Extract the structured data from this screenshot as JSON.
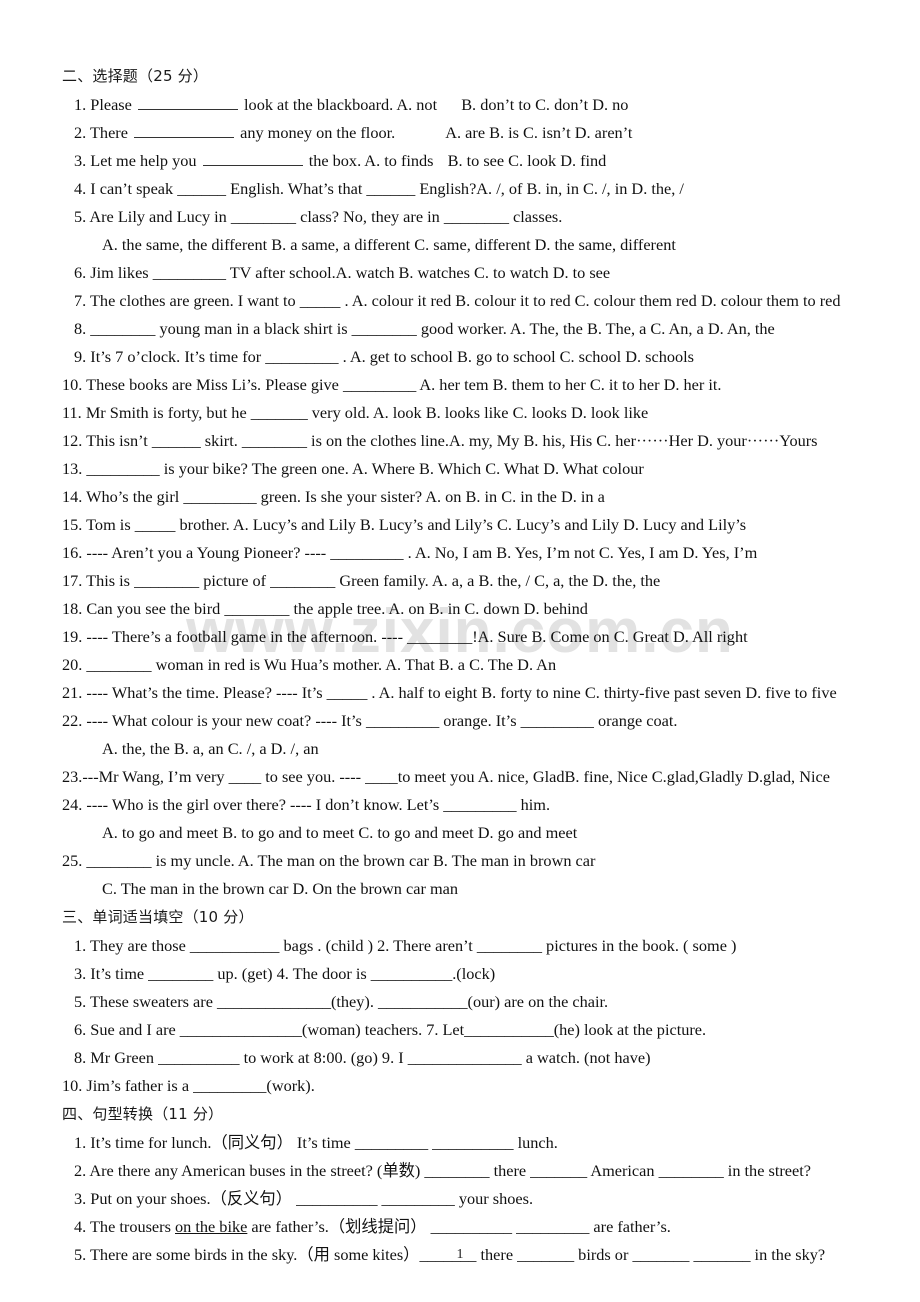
{
  "document": {
    "page_number": "1",
    "watermark": "www.zixin.com.cn"
  },
  "section2": {
    "heading": "二、选择题（25 分）",
    "questions": [
      {
        "id": "q1",
        "pre": "1. Please",
        "mid": "look at the blackboard. A. not",
        "opts": "B. don’t to     C. don’t        D. no"
      },
      {
        "id": "q2",
        "pre": "2. There",
        "mid": "any money on the floor.",
        "opts": "A. are     B. is C. isn’t   D. aren’t"
      },
      {
        "id": "q3",
        "pre": "3. Let me help you",
        "mid": "the box. A. to finds",
        "opts": "B. to see        C. look   D. find"
      },
      {
        "id": "q4",
        "line": "4. I can’t speak ______ English. What’s that ______ English?A. /, of      B. in, in   C. /, in     D. the, /"
      },
      {
        "id": "q5",
        "line": "5. Are Lily and Lucy in ________ class? No, they are in ________ classes."
      },
      {
        "id": "q5opts",
        "line": "A. the same, the different      B. a same, a different C. same, different       D. the same, different"
      },
      {
        "id": "q6",
        "line": "6. Jim likes _________ TV after school.A. watch       B. watches      C. to watch     D. to see"
      },
      {
        "id": "q7",
        "line": "7. The clothes are green. I want to _____ . A. colour it red B. colour it to red    C. colour them red  D. colour them to red"
      },
      {
        "id": "q8",
        "line": "8. ________ young man in a black shirt is ________ good worker. A. The, the    B. The, a C. An, a   D. An, the"
      },
      {
        "id": "q9",
        "line": "9. It’s 7 o’clock. It’s time for _________ . A. get to school B. go to school      C. school   D. schools"
      },
      {
        "id": "q10",
        "line": "10. These books are Miss Li’s. Please give _________ A. her tem      B. them to her C. it to her     D. her it."
      },
      {
        "id": "q11",
        "line": "11. Mr Smith is forty, but he _______ very old. A. look       B. looks like        C. looks  D. look like"
      },
      {
        "id": "q12",
        "line": "12. This isn’t ______ skirt. ________ is on the clothes line.A. my, My B. his, His C. her······Her    D. your······Yours"
      },
      {
        "id": "q13",
        "line": "13. _________ is your bike? The green one.  A. Where B. Which       C. What  D. What colour"
      },
      {
        "id": "q14",
        "line": "14. Who’s the girl _________ green. Is she your sister?      A. on       B. in       C. in the          D. in a"
      },
      {
        "id": "q15",
        "line": "15. Tom is _____ brother. A. Lucy’s and Lily       B. Lucy’s and Lily’s C. Lucy’s and Lily       D. Lucy and Lily’s"
      },
      {
        "id": "q16",
        "line": "16. ---- Aren’t you a Young Pioneer?     ---- _________ . A. No, I am B. Yes, I’m not C. Yes, I am  D. Yes, I’m"
      },
      {
        "id": "q17",
        "line": "17. This is ________ picture of ________ Green family. A. a, a     B. the, /   C, a, the   D. the, the"
      },
      {
        "id": "q18",
        "line": "18. Can you see the bird ________ the apple tree. A. on     B. in      C. down             D. behind"
      },
      {
        "id": "q19",
        "line": "19. ---- There’s a football game in the afternoon.  ---- ________!A. Sure  B. Come on    C. Great D. All right"
      },
      {
        "id": "q20",
        "line": "20. ________ woman in red is Wu Hua’s mother. A. That        B. a C. The    D. An"
      },
      {
        "id": "q21",
        "line": "21. ---- What’s the time. Please? ---- It’s _____ . A. half to eight B. forty to nine C. thirty-five past seven D. five to five"
      },
      {
        "id": "q22",
        "line": "22. ---- What colour is your new coat?   ---- It’s _________ orange. It’s _________ orange coat."
      },
      {
        "id": "q22opts",
        "line": "A. the, the              B. a, an                C. /, a            D. /, an"
      },
      {
        "id": "q23",
        "line": "23.---Mr Wang, I’m very ____ to see you. ---- ____to meet you A. nice, GladB. fine, Nice       C.glad,Gladly  D.glad, Nice"
      },
      {
        "id": "q24",
        "line": "24. ---- Who is the girl over there?    ---- I don’t know. Let’s _________ him."
      },
      {
        "id": "q24opts",
        "line": "A. to go and meet   B. to go and to meet      C. to go and meet   D. go and meet"
      },
      {
        "id": "q25",
        "line": "25. ________ is my uncle. A. The man on the brown car   B. The man in brown car"
      },
      {
        "id": "q25opts",
        "line": "C. The man in the brown car             D. On the brown car man"
      }
    ]
  },
  "section3": {
    "heading": "三、单词适当填空（10 分）",
    "items": [
      {
        "id": "f1",
        "line": "1. They are those ___________ bags . (child ) 2. There aren’t ________ pictures in the book. ( some )"
      },
      {
        "id": "f3",
        "line": "3. It’s time ________ up. (get)       4. The door is __________.(lock)"
      },
      {
        "id": "f5",
        "line": "5. These sweaters are ______________(they). ___________(our) are on the chair."
      },
      {
        "id": "f6",
        "line": "6. Sue and I are _______________(woman) teachers. 7. Let___________(he) look at the picture."
      },
      {
        "id": "f8",
        "line": "8. Mr Green __________ to work at 8:00. (go) 9. I ______________ a watch. (not have)"
      },
      {
        "id": "f10",
        "line": "10. Jim’s father is a _________(work)."
      }
    ]
  },
  "section4": {
    "heading": "四、句型转换（11 分）",
    "items": [
      {
        "id": "t1",
        "line": "1. It’s time for lunch.（同义句）    It’s time _________ __________ lunch."
      },
      {
        "id": "t2",
        "line": "2. Are there any American buses in the street? (单数) ________ there _______ American ________ in the street?"
      },
      {
        "id": "t3",
        "line": "3. Put on your shoes.（反义句）    __________ _________ your shoes."
      },
      {
        "id": "t4",
        "pre": "4. The trousers ",
        "underlined": "on the bike",
        "post": " are father’s.（划线提问）     __________ _________ are father’s."
      },
      {
        "id": "t5",
        "line": "5. There are some birds in the sky.（用 some kites）_______ there _______ birds or _______ _______ in the sky?"
      }
    ]
  }
}
